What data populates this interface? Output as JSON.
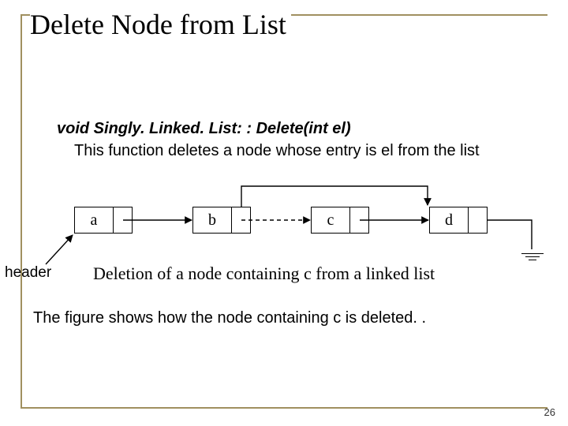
{
  "title": "Delete Node from List",
  "signature": "void Singly. Linked. List: : Delete(int el)",
  "description": "This function deletes a node whose entry is el from the list",
  "header_label": "header",
  "caption": "Deletion of a node containing c from a linked list",
  "body_text": "The figure shows how the node containing c is deleted. .",
  "page_number": "26",
  "nodes": {
    "a": "a",
    "b": "b",
    "c": "c",
    "d": "d"
  }
}
